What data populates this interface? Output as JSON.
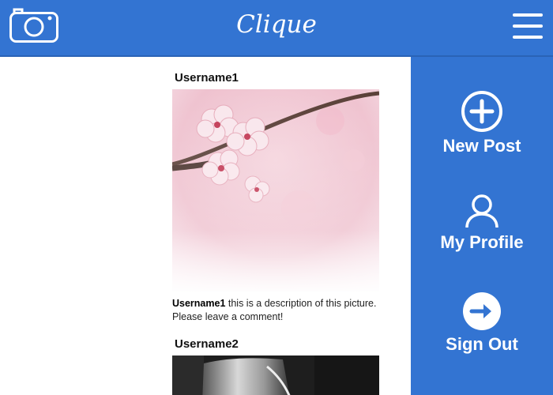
{
  "header": {
    "title": "Clique",
    "camera_icon": "camera-icon",
    "menu_icon": "hamburger-menu-icon"
  },
  "feed": {
    "posts": [
      {
        "username": "Username1",
        "image": "cherry-blossom-photo",
        "caption_user": "Username1",
        "caption_text": " this is a description of this picture. Please leave a comment!"
      },
      {
        "username": "Username2",
        "image": "coffee-photo"
      }
    ]
  },
  "sidebar": {
    "items": [
      {
        "label": "New Post",
        "icon": "plus-circle-icon"
      },
      {
        "label": "My Profile",
        "icon": "user-icon"
      },
      {
        "label": "Sign Out",
        "icon": "arrow-right-circle-icon"
      }
    ]
  },
  "colors": {
    "primary": "#3374d2",
    "white": "#ffffff",
    "text": "#222222"
  }
}
